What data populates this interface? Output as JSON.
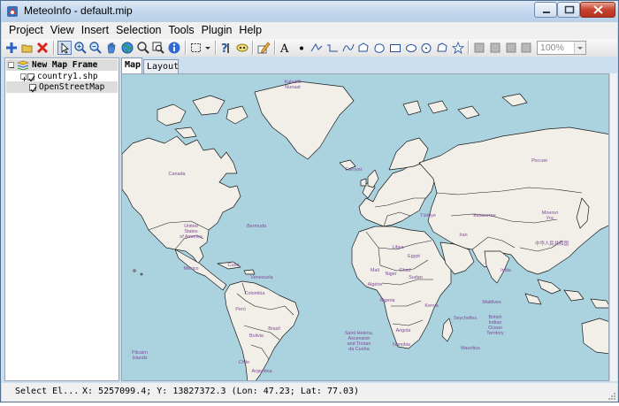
{
  "window": {
    "title": "MeteoInfo - default.mip",
    "icon": "meteoinfo-app-icon"
  },
  "menu": [
    "Project",
    "View",
    "Insert",
    "Selection",
    "Tools",
    "Plugin",
    "Help"
  ],
  "toolbar": {
    "zoom_value": "100%",
    "tools": [
      "add-layer-icon",
      "open-project-icon",
      "remove-layer-icon",
      "select-elements-icon",
      "zoom-in-icon",
      "zoom-out-icon",
      "pan-icon",
      "full-extent-icon",
      "zoom-to-layer-icon",
      "zoom-to-selection-icon",
      "identify-icon",
      "select-box-icon",
      "dropdown-icon",
      "measure-icon",
      "mask-icon",
      "edit-icon",
      "text-icon",
      "point-icon",
      "polyline-icon",
      "freehand-icon",
      "curve-icon",
      "polygon-icon",
      "closed-curve-icon",
      "rectangle-icon",
      "ellipse-icon",
      "circle-icon",
      "shape-icon",
      "star-icon"
    ]
  },
  "layers": {
    "frame": "New Map Frame",
    "items": [
      {
        "name": "country1.shp",
        "checked": true
      },
      {
        "name": "OpenStreetMap",
        "checked": true
      }
    ]
  },
  "tabs": [
    "Map",
    "Layout"
  ],
  "map_labels": [
    {
      "text": "Kalaallit\nNunaat"
    },
    {
      "text": "Canada"
    },
    {
      "text": "United\nStates\nof America"
    },
    {
      "text": "Bermuda"
    },
    {
      "text": "México"
    },
    {
      "text": "Cuba"
    },
    {
      "text": "Føroyar"
    },
    {
      "text": "Россия"
    },
    {
      "text": "Казахстан"
    },
    {
      "text": "Монгол\nУлс"
    },
    {
      "text": "中华人民共和国"
    },
    {
      "text": "India"
    },
    {
      "text": "Algérie"
    },
    {
      "text": "Brasil"
    },
    {
      "text": "Saint Helena,\nAscension\nand Tristan\nda Cunha"
    },
    {
      "text": "Pitcairn\nIslands"
    },
    {
      "text": "Maldives"
    },
    {
      "text": "British\nIndian\nOcean\nTerritory"
    },
    {
      "text": "Seychelles"
    },
    {
      "text": "Mauritius"
    },
    {
      "text": "Colombia"
    },
    {
      "text": "Perú"
    },
    {
      "text": "Chile"
    },
    {
      "text": "Argentina"
    },
    {
      "text": "Bolivia"
    },
    {
      "text": "Venezuela"
    },
    {
      "text": "Nigeria"
    },
    {
      "text": "Türkiye"
    },
    {
      "text": "Egypt"
    },
    {
      "text": "Iran"
    },
    {
      "text": "Sudan"
    },
    {
      "text": "Kenya"
    },
    {
      "text": "Angola"
    },
    {
      "text": "Namibia"
    },
    {
      "text": "Mali"
    },
    {
      "text": "Niger"
    },
    {
      "text": "Chad"
    },
    {
      "text": "Libya"
    }
  ],
  "status": {
    "mode": "Select El...",
    "coords": "X: 5257099.4; Y: 13827372.3 (Lon: 47.23; Lat: 77.03)"
  },
  "colors": {
    "ocean": "#aad3df",
    "land": "#f2efe9",
    "border": "#000000",
    "label": "#7f4a96",
    "titlebar": "#c4d8ee"
  }
}
